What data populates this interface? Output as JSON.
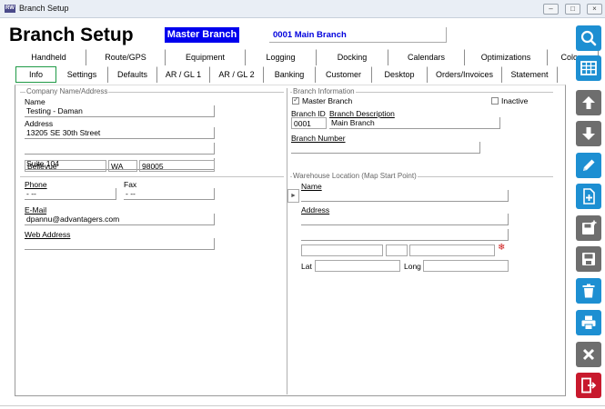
{
  "window": {
    "title": "Branch Setup",
    "app_icon": "app-logo-icon",
    "controls": [
      "minimize",
      "maximize",
      "close"
    ]
  },
  "header": {
    "title": "Branch Setup",
    "master_label": "Master Branch",
    "branch_code": "0001",
    "branch_name": "Main Branch",
    "branch_display": "0001  Main Branch"
  },
  "tabs_row1": [
    "Handheld",
    "Route/GPS",
    "Equipment",
    "Logging",
    "Docking",
    "Calendars",
    "Optimizations",
    "Colors"
  ],
  "tabs_row2": [
    "Info",
    "Settings",
    "Defaults",
    "AR / GL 1",
    "AR / GL 2",
    "Banking",
    "Customer",
    "Desktop",
    "Orders/Invoices",
    "Statement"
  ],
  "active_tab": "Info",
  "company": {
    "group_title": "Company Name/Address",
    "name_label": "Name",
    "name": "Testing - Daman",
    "address_label": "Address",
    "address1": "13205 SE 30th Street",
    "address2": "",
    "address3": "Suite 104",
    "city": "Bellevue",
    "state": "WA",
    "zip": "98005",
    "phone_label": "Phone",
    "phone": "-  --",
    "fax_label": "Fax",
    "fax": "-  --",
    "email_label": "E-Mail",
    "email": "dpannu@advantagers.com",
    "web_label": "Web Address",
    "web": ""
  },
  "branch": {
    "group_title": "Branch Information",
    "master_branch_label": "Master Branch",
    "master_branch_checked": true,
    "inactive_label": "Inactive",
    "inactive_checked": false,
    "id_label": "Branch ID",
    "id": "0001",
    "desc_label": "Branch Description",
    "desc": "Main Branch",
    "number_label": "Branch Number",
    "number": ""
  },
  "warehouse": {
    "group_title": "Warehouse Location (Map Start Point)",
    "name_label": "Name",
    "name": "",
    "address_label": "Address",
    "lat_label": "Lat",
    "lat": "",
    "long_label": "Long",
    "long": ""
  },
  "sidebar": {
    "buttons": [
      {
        "name": "search-button",
        "icon": "search-icon",
        "color": "#1d8fd2"
      },
      {
        "name": "grid-view-button",
        "icon": "grid-icon",
        "color": "#1d8fd2"
      },
      {
        "name": "previous-button",
        "icon": "arrow-up-icon",
        "color": "#6e6e6e"
      },
      {
        "name": "next-button",
        "icon": "arrow-down-icon",
        "color": "#6e6e6e"
      },
      {
        "name": "edit-button",
        "icon": "pencil-icon",
        "color": "#1d8fd2"
      },
      {
        "name": "new-button",
        "icon": "new-document-icon",
        "color": "#1d8fd2"
      },
      {
        "name": "save-as-new-button",
        "icon": "save-new-icon",
        "color": "#6e6e6e"
      },
      {
        "name": "save-button",
        "icon": "save-icon",
        "color": "#6e6e6e"
      },
      {
        "name": "delete-button",
        "icon": "trash-icon",
        "color": "#1d8fd2"
      },
      {
        "name": "print-button",
        "icon": "printer-icon",
        "color": "#1d8fd2"
      },
      {
        "name": "cancel-button",
        "icon": "x-icon",
        "color": "#6e6e6e"
      },
      {
        "name": "exit-button",
        "icon": "exit-icon",
        "color": "#c8192d"
      }
    ]
  }
}
